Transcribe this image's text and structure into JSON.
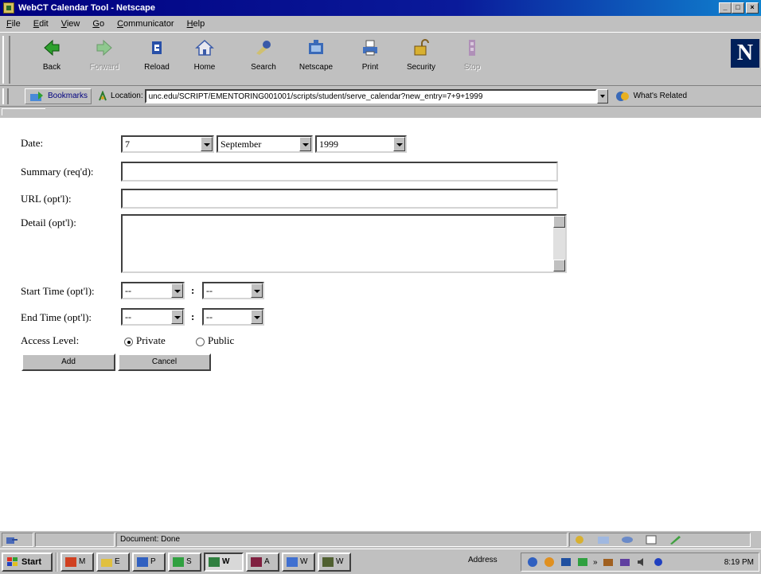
{
  "window": {
    "title": "WebCT Calendar Tool - Netscape",
    "buttons": {
      "minimize": "_",
      "maximize": "□",
      "close": "×"
    }
  },
  "menu": [
    "File",
    "Edit",
    "View",
    "Go",
    "Communicator",
    "Help"
  ],
  "toolbar": {
    "buttons": [
      {
        "label": "Back",
        "icon": "back-arrow-icon",
        "enabled": true
      },
      {
        "label": "Forward",
        "icon": "forward-arrow-icon",
        "enabled": false
      },
      {
        "label": "Reload",
        "icon": "reload-icon",
        "enabled": true
      },
      {
        "label": "Home",
        "icon": "home-icon",
        "enabled": true
      },
      {
        "label": "Search",
        "icon": "search-icon",
        "enabled": true
      },
      {
        "label": "Netscape",
        "icon": "netscape-icon",
        "enabled": true
      },
      {
        "label": "Print",
        "icon": "printer-icon",
        "enabled": true
      },
      {
        "label": "Security",
        "icon": "lock-icon",
        "enabled": true
      },
      {
        "label": "Stop",
        "icon": "stop-icon",
        "enabled": false
      }
    ],
    "logo_letter": "N"
  },
  "location_bar": {
    "bookmarks_label": "Bookmarks",
    "location_label": "Location:",
    "url": "unc.edu/SCRIPT/EMENTORING001001/scripts/student/serve_calendar?new_entry=7+9+1999",
    "whats_related_label": "What's Related"
  },
  "form": {
    "labels": {
      "date": "Date:",
      "summary": "Summary (req'd):",
      "url": "URL (opt'l):",
      "detail": "Detail (opt'l):",
      "start_time": "Start Time (opt'l):",
      "end_time": "End Time (opt'l):",
      "access_level": "Access Level:"
    },
    "date": {
      "day": "7",
      "month": "September",
      "year": "1999"
    },
    "summary_value": "",
    "url_value": "",
    "detail_value": "",
    "start_time": {
      "hour": "--",
      "minute": "--"
    },
    "end_time": {
      "hour": "--",
      "minute": "--"
    },
    "time_separator": ":",
    "access_options": {
      "private": "Private",
      "public": "Public"
    },
    "access_selected": "Private",
    "buttons": {
      "add": "Add",
      "cancel": "Cancel"
    }
  },
  "status_bar": {
    "message": "Document: Done"
  },
  "taskbar": {
    "start_label": "Start",
    "tasks": [
      {
        "label": "M",
        "active": false
      },
      {
        "label": "E",
        "active": false
      },
      {
        "label": "P",
        "active": false
      },
      {
        "label": "S",
        "active": false
      },
      {
        "label": "W",
        "active": true
      },
      {
        "label": "A",
        "active": false
      },
      {
        "label": "W",
        "active": false
      },
      {
        "label": "W",
        "active": false
      }
    ],
    "address_label": "Address",
    "tray_chevron": "»",
    "clock": "8:19 PM"
  }
}
